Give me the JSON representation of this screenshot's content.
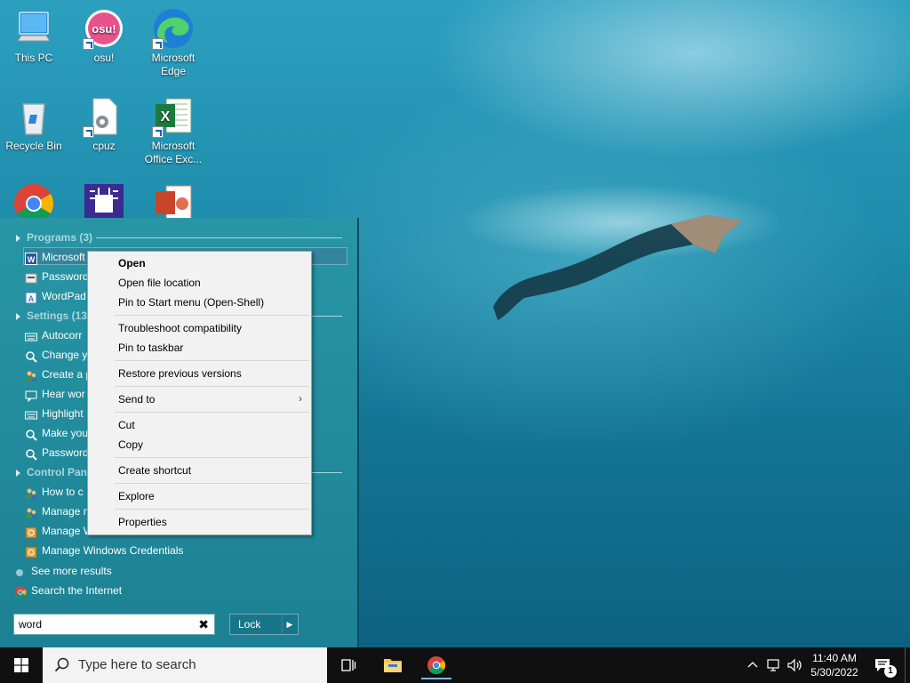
{
  "desktop": {
    "icons": [
      {
        "label": "This PC"
      },
      {
        "label": "osu!",
        "glyph": "osu!"
      },
      {
        "label": "Microsoft Edge",
        "label_line1": "Microsoft",
        "label_line2": "Edge"
      },
      {
        "label": "Recycle Bin"
      },
      {
        "label": "cpuz"
      },
      {
        "label": "Microsoft Office Exc...",
        "label_line1": "Microsoft",
        "label_line2": "Office Exc..."
      },
      {
        "label": ""
      },
      {
        "label": ""
      },
      {
        "label": ""
      }
    ]
  },
  "start_menu": {
    "categories": [
      {
        "label": "Programs (3)"
      },
      {
        "label": "Settings (13"
      },
      {
        "label": "Control Pane"
      }
    ],
    "programs": [
      {
        "label": "Microsoft",
        "icon": "word-icon"
      },
      {
        "label": "Password",
        "icon": "password-icon"
      },
      {
        "label": "WordPad",
        "icon": "wordpad-icon"
      }
    ],
    "settings": [
      {
        "label": "Autocorr",
        "icon": "keyboard-icon"
      },
      {
        "label": "Change y",
        "icon": "magnifier-icon"
      },
      {
        "label": "Create a p",
        "icon": "users-icon"
      },
      {
        "label": "Hear wor",
        "icon": "narrator-icon"
      },
      {
        "label": "Highlight",
        "icon": "keyboard-icon"
      },
      {
        "label": "Make you",
        "icon": "magnifier-icon"
      },
      {
        "label": "Password",
        "icon": "magnifier-icon"
      }
    ],
    "control_panel": [
      {
        "label": "How to c",
        "icon": "users-icon"
      },
      {
        "label": "Manage n",
        "icon": "users-icon"
      },
      {
        "label": "Manage W",
        "icon": "vault-icon"
      },
      {
        "label": "Manage Windows Credentials",
        "icon": "vault-icon"
      }
    ],
    "see_more": "See more results",
    "search_internet": "Search the Internet",
    "search_value": "word",
    "clear_glyph": "✖",
    "lock_label": "Lock",
    "lock_arrow": "▶"
  },
  "context_menu": {
    "items": [
      {
        "label": "Open"
      },
      {
        "label": "Open file location"
      },
      {
        "label": "Pin to Start menu (Open-Shell)"
      },
      {
        "label": "Troubleshoot compatibility"
      },
      {
        "label": "Pin to taskbar"
      },
      {
        "label": "Restore previous versions"
      },
      {
        "label": "Send to"
      },
      {
        "label": "Cut"
      },
      {
        "label": "Copy"
      },
      {
        "label": "Create shortcut"
      },
      {
        "label": "Explore"
      },
      {
        "label": "Properties"
      }
    ],
    "submenu_arrow": "›"
  },
  "taskbar": {
    "search_placeholder": "Type here to search",
    "time": "11:40 AM",
    "date": "5/30/2022",
    "notification_count": "1"
  },
  "colors": {
    "accent": "#0078d7",
    "taskbar": "#101010",
    "menu_panel": "#1f8c9e"
  }
}
